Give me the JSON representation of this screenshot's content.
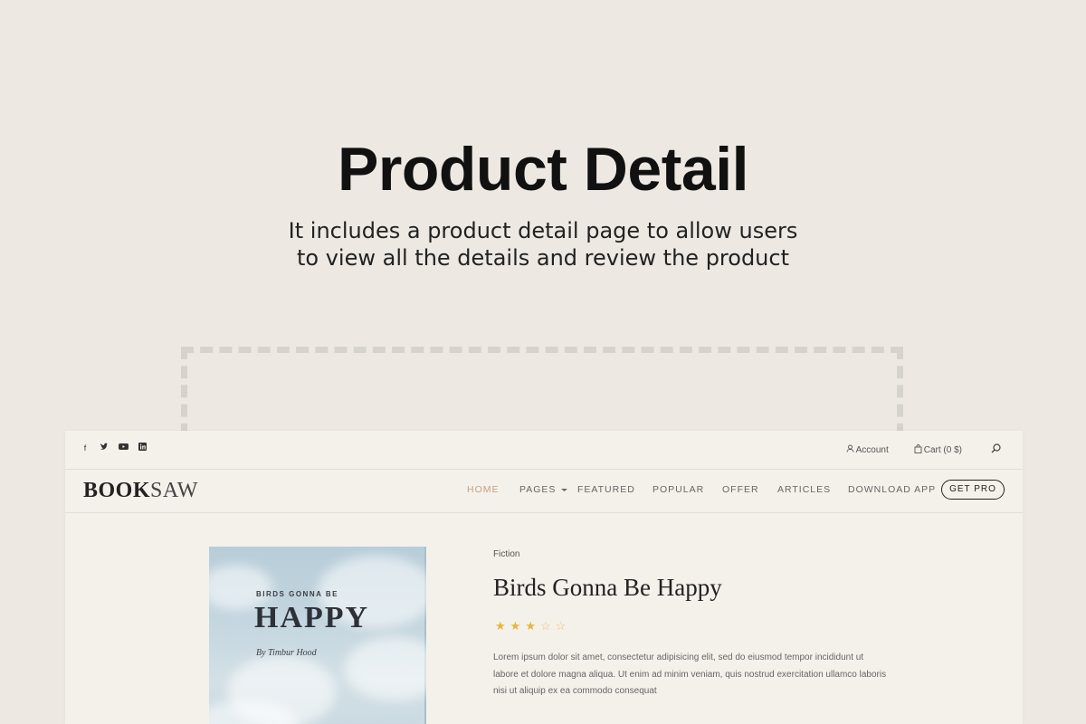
{
  "hero": {
    "title": "Product Detail",
    "subtitle_line1": "It includes a product detail page to allow users",
    "subtitle_line2": "to view all the details and review the product"
  },
  "topbar": {
    "social": [
      "facebook-icon",
      "twitter-icon",
      "youtube-icon",
      "linkedin-icon"
    ],
    "account_label": "Account",
    "cart_label": "Cart (0 $)"
  },
  "header": {
    "logo_bold": "BOOK",
    "logo_light": "SAW",
    "menu": [
      {
        "label": "HOME"
      },
      {
        "label": "PAGES"
      },
      {
        "label": "FEATURED"
      },
      {
        "label": "POPULAR"
      },
      {
        "label": "OFFER"
      },
      {
        "label": "ARTICLES"
      },
      {
        "label": "DOWNLOAD APP"
      }
    ],
    "cta_label": "GET PRO"
  },
  "product": {
    "cover_kicker": "BIRDS GONNA BE",
    "cover_title": "HAPPY",
    "cover_author": "By Timbur Hood",
    "category": "Fiction",
    "title": "Birds Gonna Be Happy",
    "rating": 3,
    "rating_max": 5,
    "description_lines": [
      "Lorem ipsum dolor sit amet, consectetur adipisicing elit, sed do eiusmod tempor incididunt ut",
      "labore et dolore magna aliqua. Ut enim ad minim veniam, quis nostrud exercitation ullamco laboris",
      "nisi ut aliquip ex ea commodo consequat"
    ]
  },
  "colors": {
    "background": "#ede9e2",
    "accent": "#c9a177",
    "star": "#e8b43a"
  }
}
